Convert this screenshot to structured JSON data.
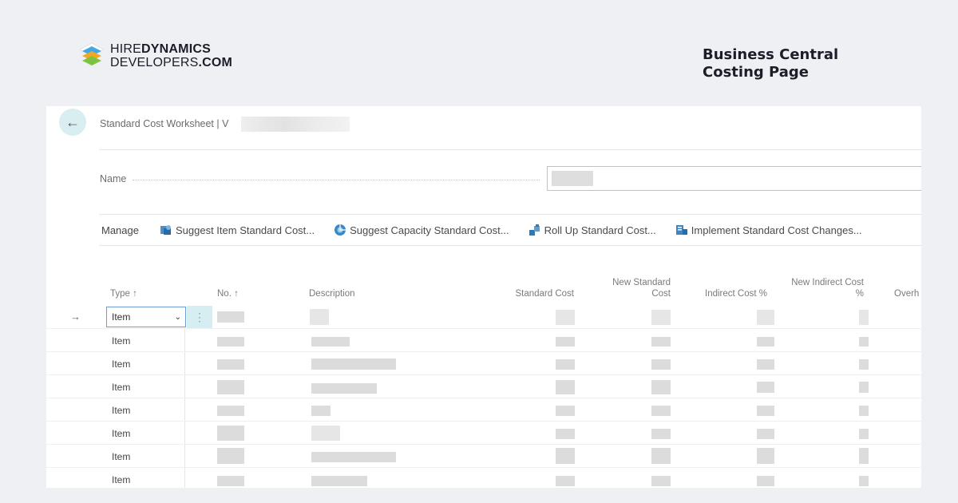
{
  "brand": {
    "line1_light": "HIRE",
    "line1_bold": "DYNAMICS",
    "line2_light": "DEVELOPERS",
    "line2_bold": ".COM",
    "colors": {
      "orange": "#f5a623",
      "blue": "#3fa9e8",
      "green": "#7ec242",
      "text": "#1c1c28"
    }
  },
  "caption": {
    "line1": "Business Central",
    "line2": "Costing Page"
  },
  "app": {
    "back_icon": "arrow-left-icon",
    "breadcrumb": "Standard Cost Worksheet | V",
    "name_label": "Name",
    "actions": {
      "manage": "Manage",
      "items": [
        {
          "label": "Suggest Item Standard Cost...",
          "icon": "suggest-item-icon"
        },
        {
          "label": "Suggest Capacity Standard Cost...",
          "icon": "suggest-capacity-icon"
        },
        {
          "label": "Roll Up Standard Cost...",
          "icon": "roll-up-icon"
        },
        {
          "label": "Implement Standard Cost Changes...",
          "icon": "implement-icon"
        }
      ]
    },
    "columns": {
      "type": "Type ↑",
      "no": "No. ↑",
      "description": "Description",
      "standard_cost": "Standard Cost",
      "new_standard_cost_1": "New Standard",
      "new_standard_cost_2": "Cost",
      "indirect_cost": "Indirect Cost %",
      "new_indirect_1": "New Indirect Cost",
      "new_indirect_2": "%",
      "overhead": "Overh"
    },
    "rows": [
      {
        "type": "Item",
        "selected": true
      },
      {
        "type": "Item"
      },
      {
        "type": "Item"
      },
      {
        "type": "Item"
      },
      {
        "type": "Item"
      },
      {
        "type": "Item"
      },
      {
        "type": "Item"
      },
      {
        "type": "Item"
      }
    ],
    "row_arrow": "→",
    "select_chevron": "⌄",
    "more_dots": "⋮"
  }
}
